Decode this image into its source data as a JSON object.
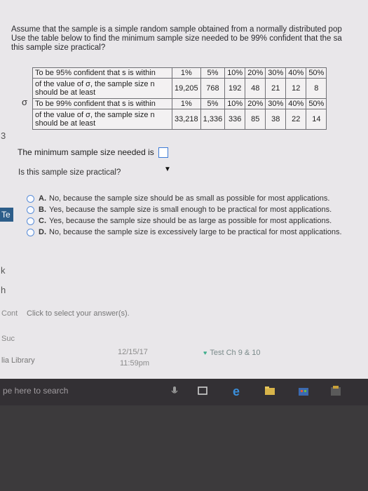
{
  "question": {
    "line1": "Assume that the sample is a simple random sample obtained from a normally distributed pop",
    "line2": "Use the table below to find the minimum sample size needed to be 99% confident that the sa",
    "line3": "this sample size practical?"
  },
  "table": {
    "sigma_symbol": "σ",
    "row95": {
      "label": "To be 95% confident that s is within",
      "percents": [
        "1%",
        "5%",
        "10%",
        "20%",
        "30%",
        "40%",
        "50%"
      ],
      "count_label": "of the value of σ, the sample size n should be at least",
      "counts": [
        "19,205",
        "768",
        "192",
        "48",
        "21",
        "12",
        "8"
      ]
    },
    "row99": {
      "label": "To be 99% confident that s is within",
      "percents": [
        "1%",
        "5%",
        "10%",
        "20%",
        "30%",
        "40%",
        "50%"
      ],
      "count_label": "of the value of σ, the sample size n should be at least",
      "counts": [
        "33,218",
        "1,336",
        "336",
        "85",
        "38",
        "22",
        "14"
      ]
    }
  },
  "answer": {
    "label": "The minimum sample size needed is",
    "value": ""
  },
  "practical_question": "Is this sample size practical?",
  "options": [
    {
      "letter": "A.",
      "text": "No, because the sample size should be as small as possible for most applications."
    },
    {
      "letter": "B.",
      "text": "Yes, because the sample size is small enough to be practical for most applications."
    },
    {
      "letter": "C.",
      "text": "Yes, because the sample size should be as large as possible for most applications."
    },
    {
      "letter": "D.",
      "text": "No, because the sample size is excessively large to be practical for most applications."
    }
  ],
  "click_select": "Click to select your answer(s).",
  "left_fragments": {
    "three": "3",
    "te": "Te",
    "k": "k",
    "h": "h",
    "cont": "Cont",
    "suc": "Suc",
    "lib": "lia Library"
  },
  "status": {
    "date": "12/15/17",
    "time": "11:59pm",
    "test": "Test Ch 9 & 10"
  },
  "taskbar": {
    "search": "pe here to search"
  },
  "colors": {
    "screen_bg": "#e9e7ea",
    "radio_border": "#5b8ed8",
    "answer_box_border": "#3d7bd6",
    "taskbar_bg": "#333034"
  }
}
